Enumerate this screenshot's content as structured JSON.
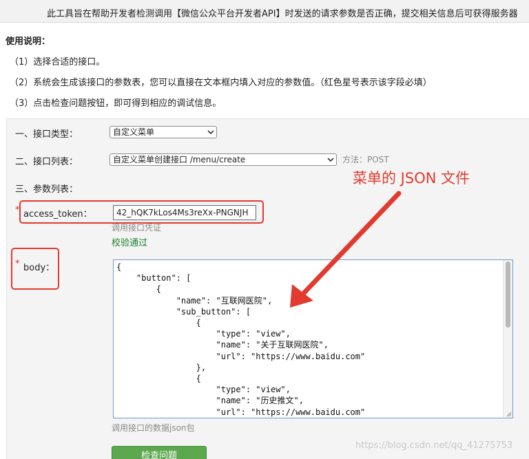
{
  "notice": "此工具旨在帮助开发者检测调用【微信公众平台开发者API】时发送的请求参数是否正确，提交相关信息后可获得服务器",
  "usage": {
    "heading": "使用说明：",
    "steps": [
      "（1）选择合适的接口。",
      "（2）系统会生成该接口的参数表，您可以直接在文本框内填入对应的参数值。（红色星号表示该字段必填）",
      "（3）点击检查问题按钮，即可得到相应的调试信息。"
    ]
  },
  "form": {
    "type_label": "一、接口类型：",
    "type_value": "自定义菜单",
    "list_label": "二、接口列表：",
    "list_value": "自定义菜单创建接口 /menu/create",
    "method": "方法：POST",
    "params_label": "三、参数列表：",
    "required_mark": "*",
    "token_label": "access_token：",
    "token_value": "42_hQK7kLos4Ms3reXx-PNGNJH",
    "token_hint": "调用接口凭证",
    "token_status": "校验通过",
    "body_label": "body：",
    "body_hint": "调用接口的数据json包",
    "check_button": "检查问题"
  },
  "body_json": "{\n    \"button\": [\n        {\n            \"name\": \"互联网医院\",\n            \"sub_button\": [\n                {\n                    \"type\": \"view\",\n                    \"name\": \"关于互联网医院\",\n                    \"url\": \"https://www.baidu.com\"\n                },\n                {\n                    \"type\": \"view\",\n                    \"name\": \"历史推文\",\n                    \"url\": \"https://www.baidu.com\"\n                },",
  "annotation": "菜单的 JSON 文件",
  "watermark": "https://blog.csdn.net/qq_41275753",
  "colors": {
    "annotation_red": "#e23a2e",
    "success_green": "#17802a",
    "button_green": "#5ba84e"
  }
}
